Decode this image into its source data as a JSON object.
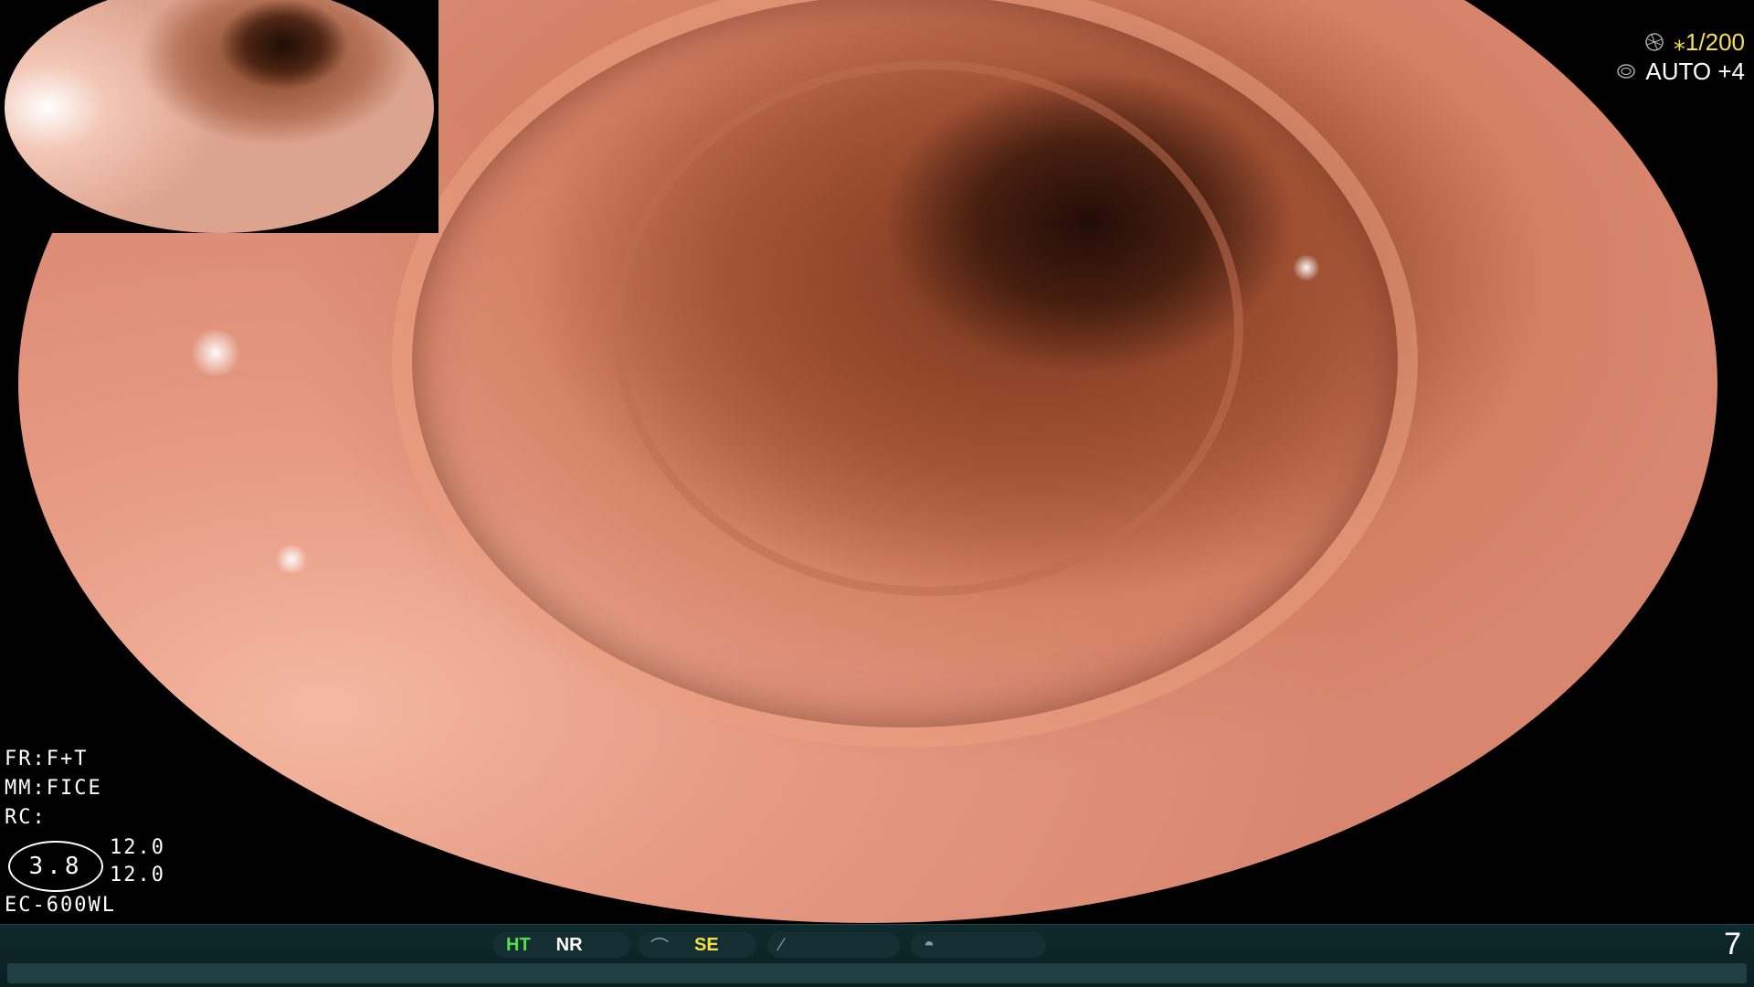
{
  "top_right": {
    "shutter_icon": "aperture-icon",
    "shutter_value": "⁎1/200",
    "iris_icon": "iris-icon",
    "iris_value": "AUTO +4"
  },
  "overlay": {
    "fr": "FR:F+T",
    "mm": "MM:FICE",
    "rc": "RC:",
    "badge_value": "3.8",
    "value_top": "12.0",
    "value_bottom": "12.0",
    "scope_model": "EC-600WL"
  },
  "status_bar": {
    "ht": "HT",
    "nr": "NR",
    "se": "SE",
    "page_number": "7",
    "colors": {
      "ht": "#55e04a",
      "se": "#f4e04a"
    }
  }
}
